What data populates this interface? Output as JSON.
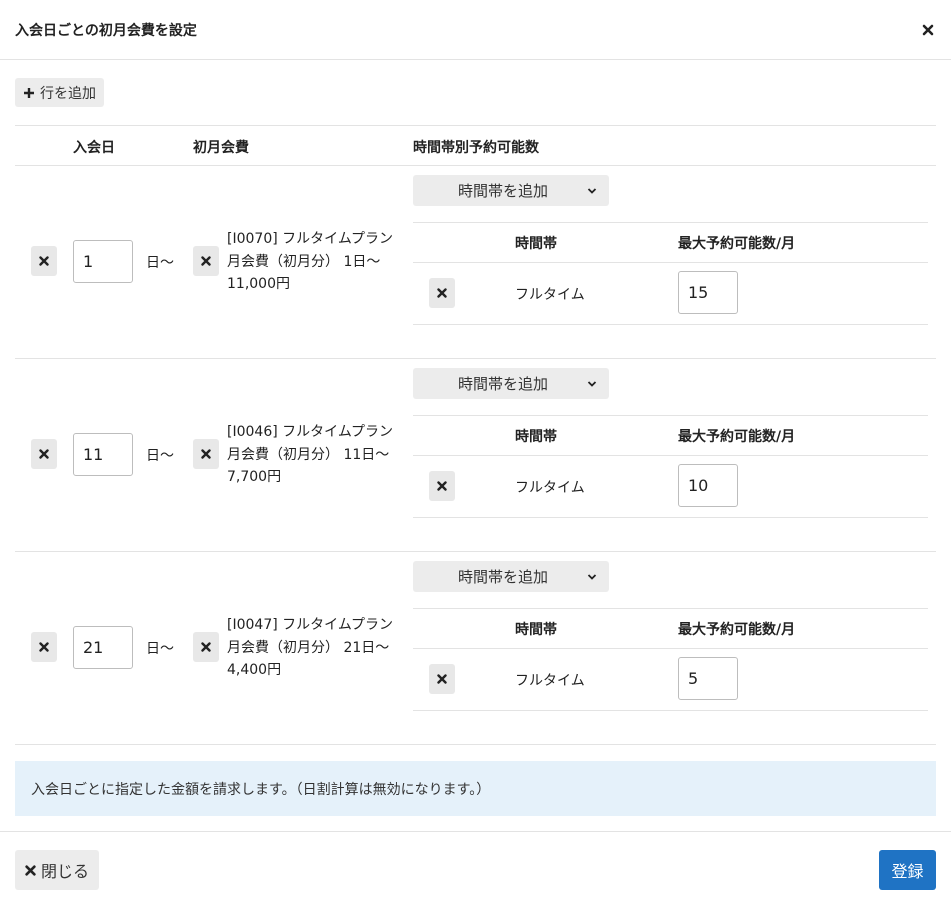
{
  "dialog": {
    "title": "入会日ごとの初月会費を設定",
    "add_row_label": "行を追加",
    "info_message": "入会日ごとに指定した金額を請求します。（日割計算は無効になります。）",
    "close_label": "閉じる",
    "submit_label": "登録"
  },
  "table": {
    "headers": {
      "join_day": "入会日",
      "first_fee": "初月会費",
      "slots": "時間帯別予約可能数"
    },
    "sub_headers": {
      "slot": "時間帯",
      "max": "最大予約可能数/月"
    },
    "add_slot_label": "時間帯を追加",
    "day_suffix": "日〜",
    "rows": [
      {
        "join_day": "1",
        "fee_line1": "[I0070] フルタイムプラン",
        "fee_line2": "月会費（初月分） 1日〜",
        "fee_line3": "11,000円",
        "slots": [
          {
            "name": "フルタイム",
            "max": "15"
          }
        ]
      },
      {
        "join_day": "11",
        "fee_line1": "[I0046] フルタイムプラン",
        "fee_line2": "月会費（初月分） 11日〜",
        "fee_line3": "7,700円",
        "slots": [
          {
            "name": "フルタイム",
            "max": "10"
          }
        ]
      },
      {
        "join_day": "21",
        "fee_line1": "[I0047] フルタイムプラン",
        "fee_line2": "月会費（初月分） 21日〜",
        "fee_line3": "4,400円",
        "slots": [
          {
            "name": "フルタイム",
            "max": "5"
          }
        ]
      }
    ]
  },
  "colors": {
    "primary": "#1f73c4",
    "info_bg": "#e5f1fa",
    "button_gray": "#ececec"
  },
  "icons": {
    "close": "close-icon",
    "plus": "plus-icon",
    "chevron": "chevron-down-icon"
  }
}
